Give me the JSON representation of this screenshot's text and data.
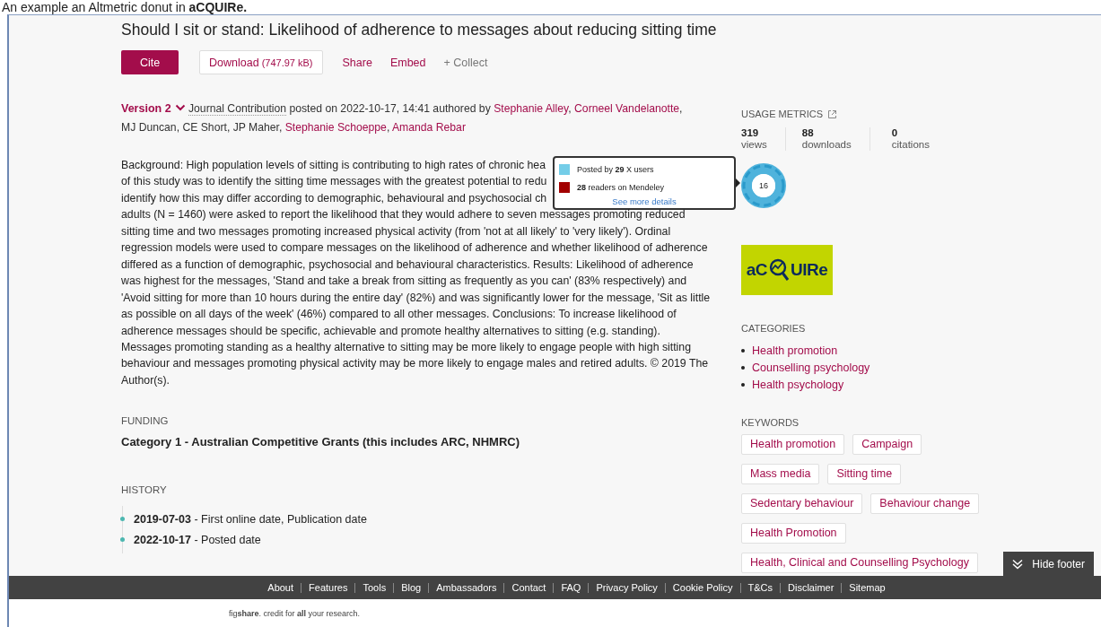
{
  "caption": {
    "text": "An example an Altmetric donut in **aCQUIRe.**"
  },
  "title": "Should I sit or stand: Likelihood of adherence to messages about reducing sitting time",
  "actions": [
    {
      "label": "Cite",
      "kind": "primary"
    },
    {
      "label": "Download",
      "detail": "(747.97 kB)",
      "kind": "outlined"
    },
    {
      "label": "Share",
      "kind": "link"
    },
    {
      "label": "Embed",
      "kind": "link"
    },
    {
      "label": "+ Collect",
      "kind": "muted"
    }
  ],
  "meta": {
    "version": "Version 2",
    "item_type": "Journal Contribution",
    "posted": "posted on 2022-10-17, 14:41 authored by",
    "separator": ",",
    "authors": [
      {
        "name": "Stephanie Alley",
        "linked": true
      },
      {
        "name": "Corneel Vandelanotte",
        "linked": true
      },
      {
        "name": "MJ Duncan",
        "linked": false
      },
      {
        "name": "CE Short",
        "linked": false
      },
      {
        "name": "JP Maher",
        "linked": false
      },
      {
        "name": "Stephanie Schoeppe",
        "linked": true
      },
      {
        "name": "Amanda Rebar",
        "linked": true
      }
    ]
  },
  "abstract_lines": [
    "Background: High population levels of sitting is contributing to high rates of chronic hea",
    "of this study was to identify the sitting time messages with the greatest potential to redu",
    "identify how this may differ according to demographic, behavioural and psychosocial ch",
    "adults (N = 1460) were asked to report the likelihood that they would adhere to seven messages promoting reduced",
    "sitting time and two messages promoting increased physical activity (from 'not at all likely' to 'very likely'). Ordinal",
    "regression models were used to compare messages on the likelihood of adherence and whether likelihood of adherence",
    "differed as a function of demographic, psychosocial and behavioural characteristics. Results: Likelihood of adherence",
    "was highest for the messages, 'Stand and take a break from sitting as frequently as you can' (83% respectively) and",
    "'Avoid sitting for more than 10 hours during the entire day' (82%) and was significantly lower for the message, 'Sit as little",
    "as possible on all days of the week' (46%) compared to all other messages. Conclusions: To increase likelihood of",
    "adherence messages should be specific, achievable and promote healthy alternatives to sitting (e.g. standing).",
    "Messages promoting standing as a healthy alternative to sitting may be more likely to engage people with high sitting",
    "behaviour and messages promoting physical activity may be more likely to engage males and retired adults. © 2019 The",
    "Author(s)."
  ],
  "funding": {
    "heading": "FUNDING",
    "text": "Category 1 - Australian Competitive Grants (this includes ARC, NHMRC)"
  },
  "history": {
    "heading": "HISTORY",
    "items": [
      {
        "date": "2019-07-03",
        "text": " - First online date, Publication date"
      },
      {
        "date": "2022-10-17",
        "text": " - Posted date"
      }
    ]
  },
  "usage": {
    "heading": "USAGE METRICS",
    "metrics": [
      {
        "value": "319",
        "label": "views"
      },
      {
        "value": "88",
        "label": "downloads"
      },
      {
        "value": "0",
        "label": "citations"
      }
    ]
  },
  "altmetric": {
    "score": "16",
    "tooltip": {
      "items": [
        {
          "text": "Posted by **29** X users",
          "color": "#74cde8"
        },
        {
          "text": "**28** readers on Mendeley",
          "color": "#a20000"
        }
      ],
      "link": "See more details"
    }
  },
  "logo": {
    "before": "aC",
    "after": "UIRe"
  },
  "categories": {
    "heading": "CATEGORIES",
    "items": [
      "Health promotion",
      "Counselling psychology",
      "Health psychology"
    ]
  },
  "keywords": {
    "heading": "KEYWORDS",
    "rows": [
      [
        "Health promotion",
        "Campaign"
      ],
      [
        "Mass media",
        "Sitting time"
      ],
      [
        "Sedentary behaviour",
        "Behaviour change"
      ],
      [
        "Health Promotion"
      ],
      [
        "Health, Clinical and Counselling Psychology"
      ]
    ]
  },
  "footer": {
    "links": [
      "About",
      "Features",
      "Tools",
      "Blog",
      "Ambassadors",
      "Contact",
      "FAQ",
      "Privacy Policy",
      "Cookie Policy",
      "T&Cs",
      "Disclaimer",
      "Sitemap"
    ],
    "tagline": "fig**share**. credit for **all** your research.",
    "hide_button": "Hide footer"
  }
}
